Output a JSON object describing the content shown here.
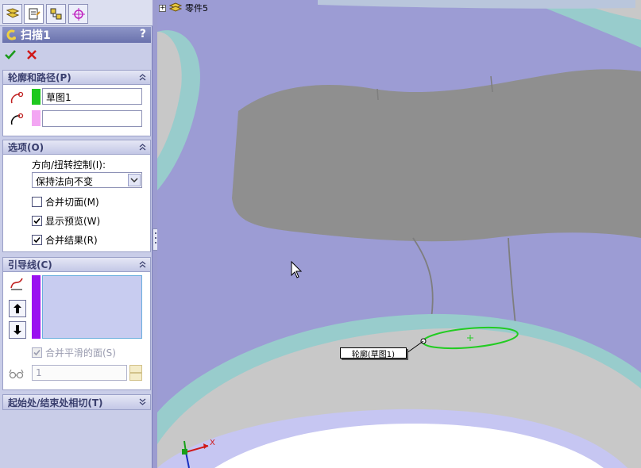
{
  "feature": {
    "title": "扫描1",
    "help": "?"
  },
  "tabs": [
    "feature-manager-icon",
    "property-manager-icon",
    "configuration-manager-icon",
    "dimxpert-icon"
  ],
  "profile_path": {
    "header": "轮廓和路径(P)",
    "profile_value": "草图1",
    "path_value": "",
    "profile_color": "#1ec81e",
    "path_color": "#f3a6f3"
  },
  "options": {
    "header": "选项(O)",
    "orientation_label": "方向/扭转控制(I):",
    "orientation_value": "保持法向不变",
    "merge_tangent": {
      "label": "合并切面(M)",
      "checked": false
    },
    "show_preview": {
      "label": "显示预览(W)",
      "checked": true
    },
    "merge_result": {
      "label": "合并结果(R)",
      "checked": true
    }
  },
  "guide_curves": {
    "header": "引导线(C)",
    "merge_smooth": {
      "label": "合并平滑的面(S)",
      "checked": true,
      "disabled": true
    },
    "sections_value": "1",
    "list_color": "#9a10f0"
  },
  "tangency": {
    "header": "起始处/结束处相切(T)"
  },
  "viewport": {
    "part_name": "零件5",
    "callout": "轮廓(草图1)",
    "axis_x": "X"
  },
  "colors": {
    "accent": "#6a72ad",
    "model_gray": "#8e8e8e",
    "selection_green": "#22cc22"
  }
}
